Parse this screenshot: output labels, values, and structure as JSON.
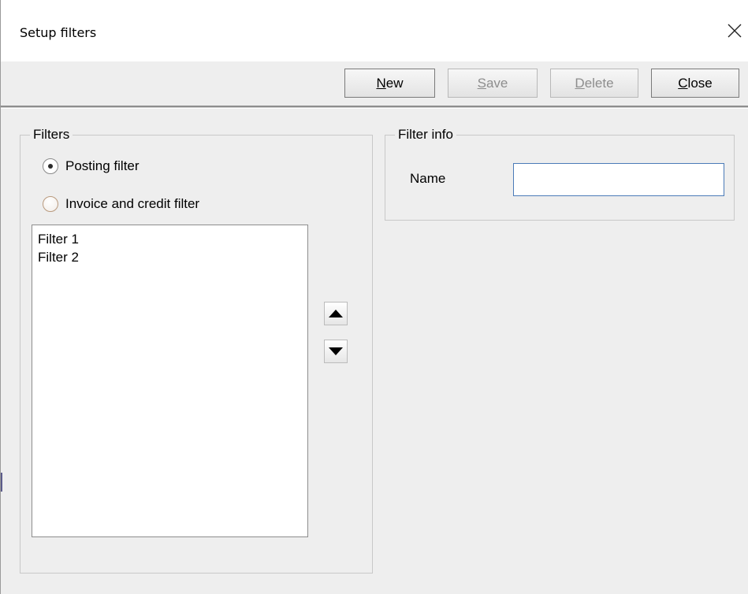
{
  "window": {
    "title": "Setup filters"
  },
  "toolbar": {
    "new": {
      "label": "New",
      "mnemonic": "N",
      "rest": "ew",
      "enabled": true
    },
    "save": {
      "label": "Save",
      "mnemonic": "S",
      "rest": "ave",
      "enabled": false
    },
    "delete": {
      "label": "Delete",
      "mnemonic": "D",
      "rest": "elete",
      "enabled": false
    },
    "close": {
      "label": "Close",
      "mnemonic": "C",
      "rest": "lose",
      "enabled": true
    }
  },
  "filters_group": {
    "title": "Filters",
    "options": [
      {
        "label": "Posting filter",
        "selected": true
      },
      {
        "label": "Invoice and credit filter",
        "selected": false
      }
    ],
    "list_items": [
      "Filter 1",
      "Filter 2"
    ]
  },
  "info_group": {
    "title": "Filter info",
    "name_label": "Name",
    "name_value": ""
  },
  "colors": {
    "background": "#eeeeee",
    "input_border": "#4b7bb8",
    "disabled_text": "#8d8d8d"
  },
  "icons": [
    "close-icon",
    "arrow-up-icon",
    "arrow-down-icon"
  ]
}
